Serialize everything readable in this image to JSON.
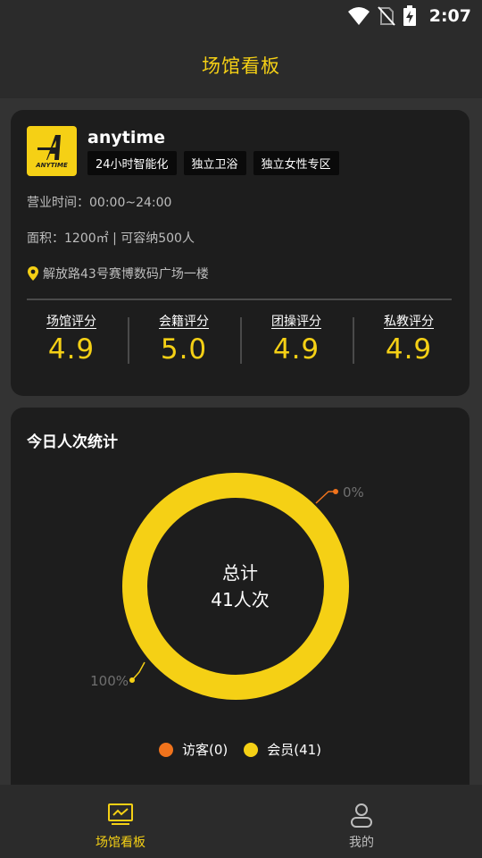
{
  "status_bar": {
    "time": "2:07"
  },
  "header": {
    "title": "场馆看板"
  },
  "gym": {
    "logo_text": "ANYTIME",
    "name": "anytime",
    "tags": [
      "24小时智能化",
      "独立卫浴",
      "独立女性专区"
    ],
    "hours": "营业时间：00:00~24:00",
    "area": "面积：1200㎡ | 可容纳500人",
    "address": "解放路43号赛博数码广场一楼",
    "ratings": [
      {
        "label": "场馆评分",
        "value": "4.9"
      },
      {
        "label": "会籍评分",
        "value": "5.0"
      },
      {
        "label": "团操评分",
        "value": "4.9"
      },
      {
        "label": "私教评分",
        "value": "4.9"
      }
    ]
  },
  "stats": {
    "title": "今日人次统计",
    "center_label": "总计",
    "center_value": "41人次",
    "legend": [
      {
        "label": "访客(0)",
        "color": "#f0731c"
      },
      {
        "label": "会员(41)",
        "color": "#f5d015"
      }
    ]
  },
  "chart_data": {
    "type": "pie",
    "series": [
      {
        "name": "访客",
        "value": 0,
        "percent_label": "0%",
        "color": "#f0731c"
      },
      {
        "name": "会员",
        "value": 41,
        "percent_label": "100%",
        "color": "#f5d015"
      }
    ]
  },
  "bottom_nav": {
    "items": [
      {
        "label": "场馆看板",
        "active": true,
        "icon": "dashboard-icon"
      },
      {
        "label": "我的",
        "active": false,
        "icon": "user-icon"
      }
    ]
  },
  "colors": {
    "accent": "#f5d015",
    "visitor": "#f0731c",
    "inactive_nav": "#bdbdbd"
  }
}
